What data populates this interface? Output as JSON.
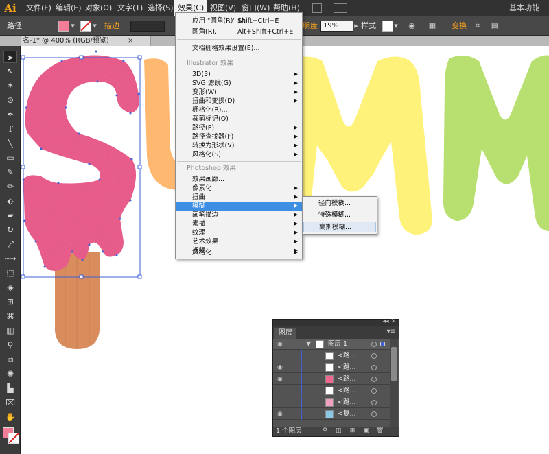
{
  "app": {
    "logo": "Ai",
    "workspace": "基本功能"
  },
  "menubar": {
    "items": [
      {
        "label": "文件(F)"
      },
      {
        "label": "编辑(E)"
      },
      {
        "label": "对象(O)"
      },
      {
        "label": "文字(T)"
      },
      {
        "label": "选择(S)"
      },
      {
        "label": "效果(C)"
      },
      {
        "label": "视图(V)"
      },
      {
        "label": "窗口(W)"
      },
      {
        "label": "帮助(H)"
      }
    ]
  },
  "controlbar": {
    "selection_type": "路径",
    "stroke_label": "描边",
    "opacity_label": "明度",
    "opacity_value": "19%",
    "style_label": "样式",
    "transform_label": "变换",
    "fill_color": "#f27e9a"
  },
  "document": {
    "tab_title": "名-1* @ 400% (RGB/预览)",
    "close_glyph": "×"
  },
  "effect_menu": {
    "apply_last": {
      "label": "应用 \"圆角(R)\" (A)",
      "shortcut": "Shift+Ctrl+E"
    },
    "last_effect": {
      "label": "圆角(R)...",
      "shortcut": "Alt+Shift+Ctrl+E"
    },
    "raster_settings": "文档栅格效果设置(E)...",
    "illustrator_header": "Illustrator 效果",
    "illustrator_items": [
      {
        "label": "3D(3)",
        "submenu": true
      },
      {
        "label": "SVG 滤镜(G)",
        "submenu": true
      },
      {
        "label": "变形(W)",
        "submenu": true
      },
      {
        "label": "扭曲和变换(D)",
        "submenu": true
      },
      {
        "label": "栅格化(R)...",
        "submenu": false
      },
      {
        "label": "裁剪标记(O)",
        "submenu": false
      },
      {
        "label": "路径(P)",
        "submenu": true
      },
      {
        "label": "路径查找器(F)",
        "submenu": true
      },
      {
        "label": "转换为形状(V)",
        "submenu": true
      },
      {
        "label": "风格化(S)",
        "submenu": true
      }
    ],
    "photoshop_header": "Photoshop 效果",
    "photoshop_items": [
      {
        "label": "效果画廊...",
        "submenu": false
      },
      {
        "label": "像素化",
        "submenu": true
      },
      {
        "label": "扭曲",
        "submenu": true
      },
      {
        "label": "模糊",
        "submenu": true
      },
      {
        "label": "画笔描边",
        "submenu": true
      },
      {
        "label": "素描",
        "submenu": true
      },
      {
        "label": "纹理",
        "submenu": true
      },
      {
        "label": "艺术效果",
        "submenu": true
      },
      {
        "label": "视频",
        "submenu": true
      },
      {
        "label": "风格化",
        "submenu": true
      }
    ],
    "highlighted": "模糊"
  },
  "blur_submenu": {
    "items": [
      {
        "label": "径向模糊..."
      },
      {
        "label": "特殊模糊..."
      },
      {
        "label": "高斯模糊..."
      }
    ],
    "hovered": "高斯模糊..."
  },
  "layers_panel": {
    "tab": "图层",
    "layer_name": "图层 1",
    "rows": [
      {
        "name": "<路...",
        "visible": false,
        "thumb_color": "#ffffff"
      },
      {
        "name": "<路...",
        "visible": true,
        "thumb_color": "#f4f4f4"
      },
      {
        "name": "<路...",
        "visible": true,
        "thumb_color": "#f06890"
      },
      {
        "name": "<路...",
        "visible": false,
        "thumb_color": "#ffffff"
      },
      {
        "name": "<路...",
        "visible": false,
        "thumb_color": "#f2a0c0"
      },
      {
        "name": "<复...",
        "visible": true,
        "thumb_color": "#8ac8e8"
      }
    ],
    "footer": "1 个图层"
  },
  "artwork": {
    "letters": [
      "S",
      "U",
      "M",
      "M"
    ],
    "colors": {
      "s_pink": "#f06090",
      "u_orange": "#ffb870",
      "m_yellow": "#fff27a",
      "m_green": "#b8e070",
      "stick": "#d98c5c",
      "selection": "#3f60d6"
    }
  }
}
